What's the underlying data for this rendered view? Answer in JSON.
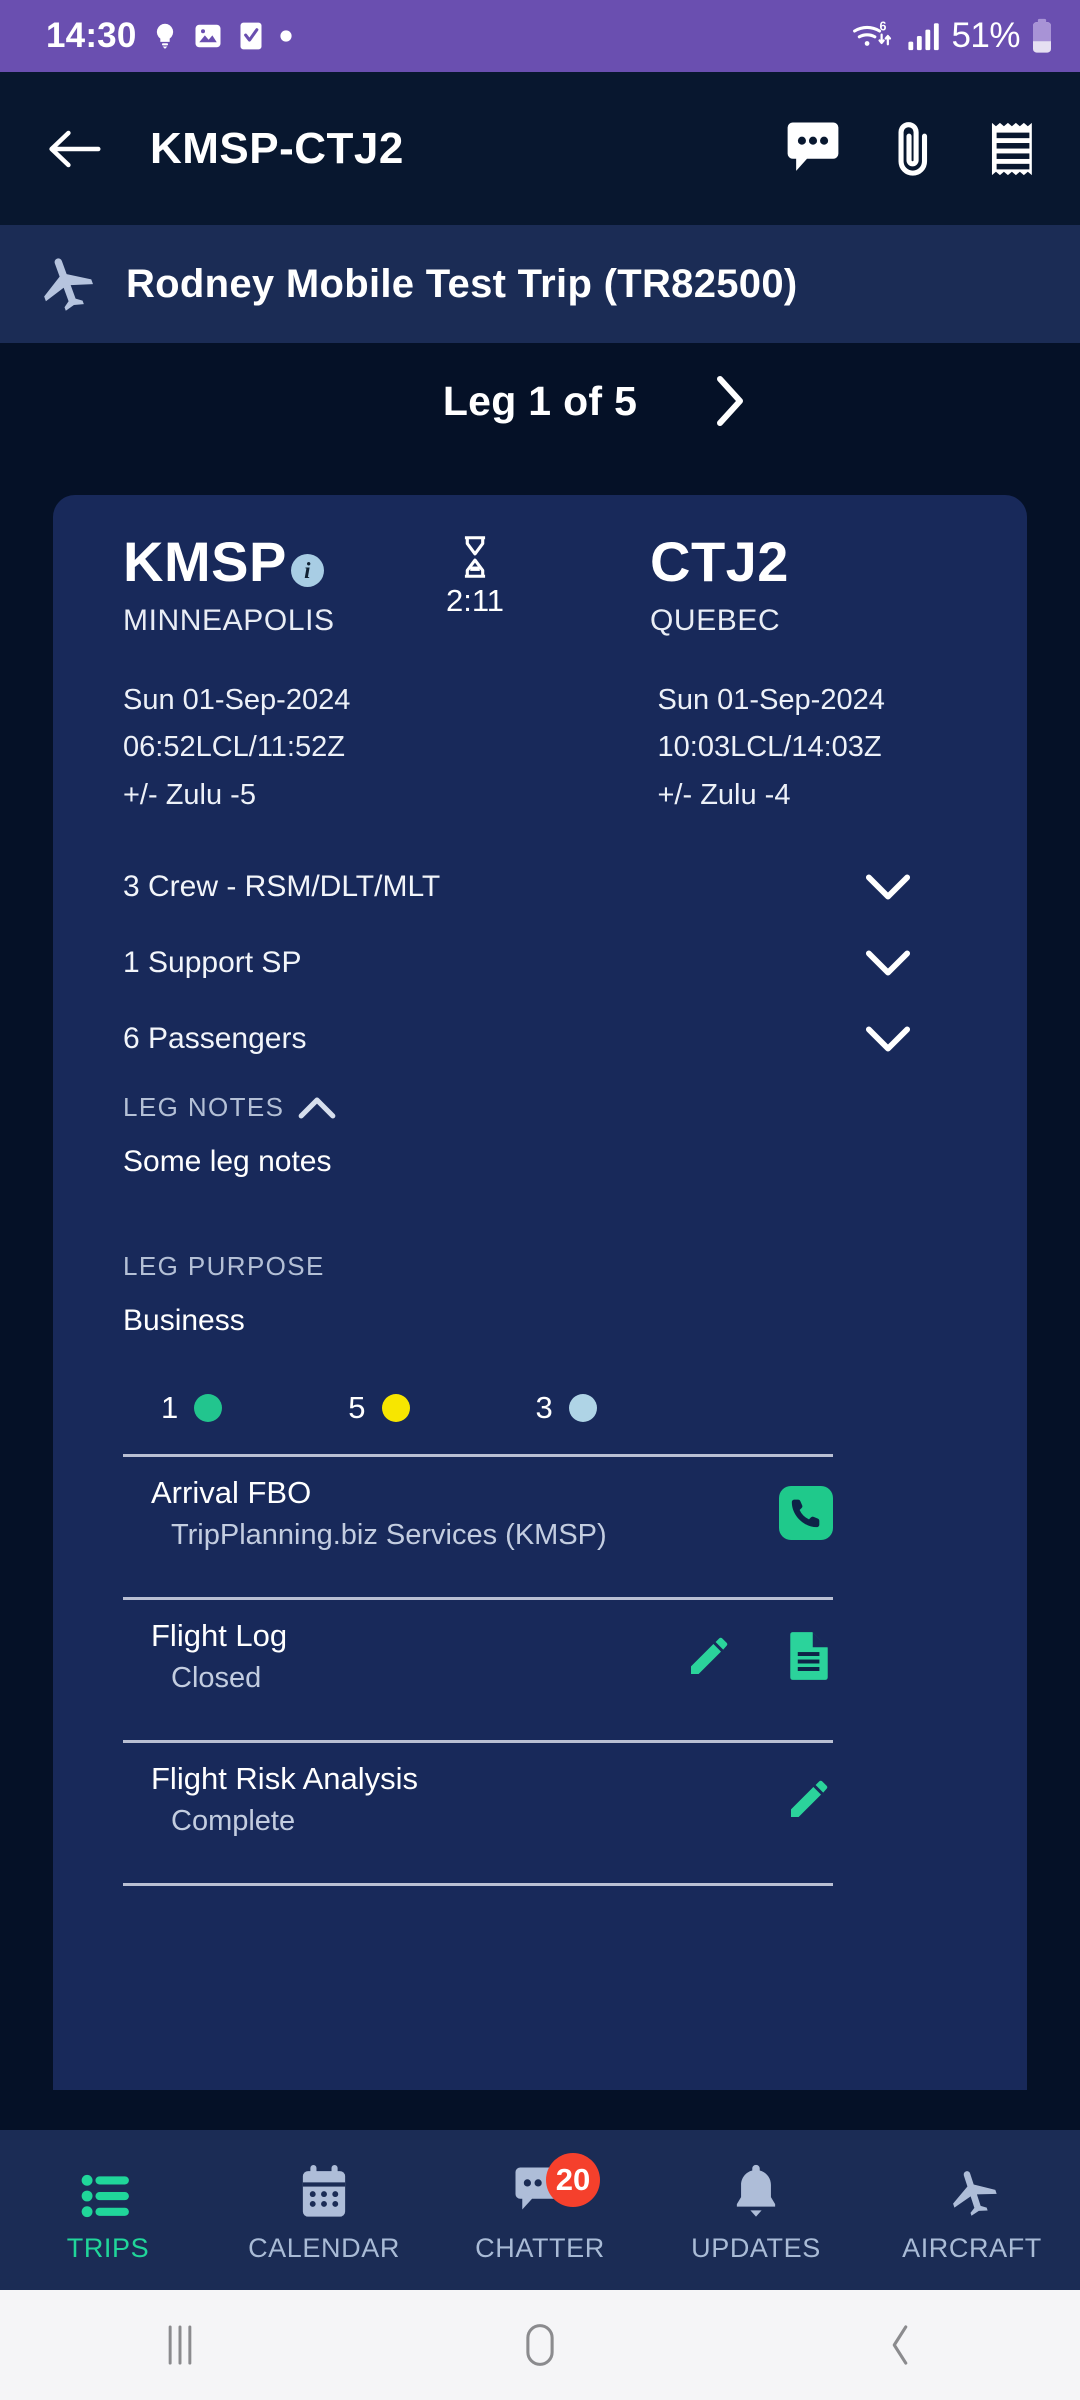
{
  "status_bar": {
    "time": "14:30",
    "battery_percent": "51%",
    "icons": [
      "lightbulb-icon",
      "image-icon",
      "checkbox-icon",
      "dot-icon",
      "wifi-6-icon",
      "cellular-signal-icon",
      "battery-icon"
    ]
  },
  "app_bar": {
    "back_icon": "back-arrow-icon",
    "title": "KMSP-CTJ2",
    "actions": [
      "chat-icon",
      "paperclip-icon",
      "receipt-icon"
    ]
  },
  "trip_bar": {
    "icon": "airplane-icon",
    "title": "Rodney Mobile Test Trip (TR82500)"
  },
  "leg_nav": {
    "label": "Leg 1 of 5",
    "next_icon": "chevron-right-icon"
  },
  "leg": {
    "departure": {
      "code": "KMSP",
      "city": "MINNEAPOLIS",
      "date": "Sun 01-Sep-2024",
      "time": "06:52LCL/11:52Z",
      "zulu": "+/- Zulu -5",
      "info_badge": "i"
    },
    "arrival": {
      "code": "CTJ2",
      "city": "QUEBEC",
      "date": "Sun 01-Sep-2024",
      "time": "10:03LCL/14:03Z",
      "zulu": "+/- Zulu -4"
    },
    "duration": "2:11",
    "duration_icon": "hourglass-icon",
    "expandable_rows": [
      {
        "label": "3 Crew  - RSM/DLT/MLT",
        "icon": "chevron-down-icon"
      },
      {
        "label": "1 Support SP",
        "icon": "chevron-down-icon"
      },
      {
        "label": "6 Passengers",
        "icon": "chevron-down-icon"
      }
    ],
    "notes_section": {
      "heading": "LEG NOTES",
      "toggle_icon": "chevron-up-icon",
      "body": "Some leg notes"
    },
    "purpose_section": {
      "heading": "LEG PURPOSE",
      "body": "Business"
    },
    "status_dots": [
      {
        "count": "1",
        "color": "#22C58E"
      },
      {
        "count": "5",
        "color": "#F7E600"
      },
      {
        "count": "3",
        "color": "#AFD4E6"
      }
    ],
    "list_rows": [
      {
        "title": "Arrival FBO",
        "subtitle": "TripPlanning.biz Services (KMSP)",
        "actions": [
          "phone-icon"
        ]
      },
      {
        "title": "Flight Log",
        "subtitle": "Closed",
        "actions": [
          "pencil-icon",
          "document-icon"
        ]
      },
      {
        "title": "Flight Risk Analysis",
        "subtitle": "Complete",
        "actions": [
          "pencil-icon"
        ]
      }
    ]
  },
  "bottom_nav": {
    "items": [
      {
        "label": "TRIPS",
        "icon": "list-icon",
        "active": true,
        "badge": ""
      },
      {
        "label": "CALENDAR",
        "icon": "calendar-icon",
        "active": false,
        "badge": ""
      },
      {
        "label": "CHATTER",
        "icon": "chat-icon",
        "active": false,
        "badge": "20"
      },
      {
        "label": "UPDATES",
        "icon": "bell-icon",
        "active": false,
        "badge": ""
      },
      {
        "label": "AIRCRAFT",
        "icon": "airplane-icon",
        "active": false,
        "badge": ""
      }
    ]
  },
  "system_nav": {
    "recents_icon": "recents-icon",
    "home_icon": "home-icon",
    "back_icon": "back-icon"
  },
  "colors": {
    "status_bar": "#6A4FB0",
    "app_bar": "#08172F",
    "trip_bar": "#1B2C55",
    "page_bg": "#051127",
    "card": "#18295A",
    "accent_green": "#20D69A",
    "badge_red": "#F5402C"
  }
}
